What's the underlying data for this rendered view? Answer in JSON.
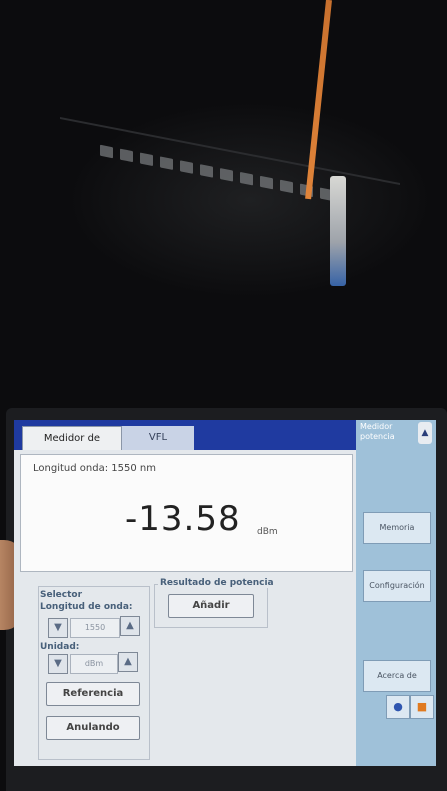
{
  "tabs": [
    {
      "label": "Medidor de potencia"
    },
    {
      "label": "VFL"
    }
  ],
  "sidebar": {
    "title": "Medidor potencia",
    "buttons": [
      {
        "label": "Memoria"
      },
      {
        "label": "Configuración"
      },
      {
        "label": "Acerca de"
      }
    ]
  },
  "reading": {
    "wavelength_text": "Longitud onda: 1550 nm",
    "value": "-13.58",
    "unit": "dBm"
  },
  "selector": {
    "title": "Selector",
    "wavelength_label": "Longitud de onda:",
    "wavelength_value": "1550",
    "unit_label": "Unidad:",
    "unit_value": "dBm",
    "reference_button": "Referencia",
    "cancel_button": "Anulando"
  },
  "result": {
    "title": "Resultado de potencia",
    "add_button": "Añadir"
  },
  "colors": {
    "tab_bar": "#1f3aa0",
    "sidebar": "#9fc1d9",
    "screen_bg": "#e4e8ec"
  }
}
